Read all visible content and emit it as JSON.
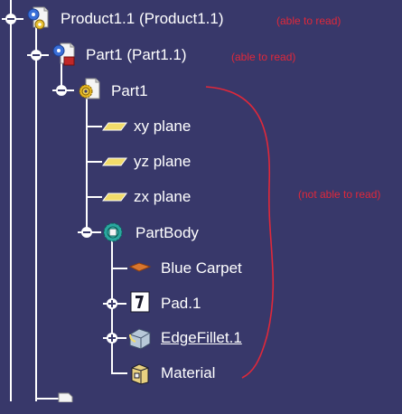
{
  "tree": {
    "product": {
      "label": "Product1.1 (Product1.1)",
      "icon": "product-icon"
    },
    "part_instance": {
      "label": "Part1 (Part1.1)",
      "icon": "part-instance-icon"
    },
    "part": {
      "label": "Part1",
      "icon": "part-gear-icon"
    },
    "xy_plane": {
      "label": "xy plane",
      "icon": "plane-icon"
    },
    "yz_plane": {
      "label": "yz plane",
      "icon": "plane-icon"
    },
    "zx_plane": {
      "label": "zx plane",
      "icon": "plane-icon"
    },
    "part_body": {
      "label": "PartBody",
      "icon": "partbody-icon"
    },
    "blue_carpet": {
      "label": "Blue Carpet",
      "icon": "material-swatch-icon"
    },
    "pad": {
      "label": "Pad.1",
      "icon": "pad-icon"
    },
    "edge_fillet": {
      "label": "EdgeFillet.1",
      "icon": "edgefillet-icon"
    },
    "material": {
      "label": "Material",
      "icon": "material-icon"
    }
  },
  "annotations": {
    "product_note": "(able to read)",
    "part_note": "(able to read)",
    "bracket_note": "(not able to read)"
  },
  "colors": {
    "background": "#38386a",
    "tree_line": "#ffffff",
    "annotation": "#e0283a"
  }
}
